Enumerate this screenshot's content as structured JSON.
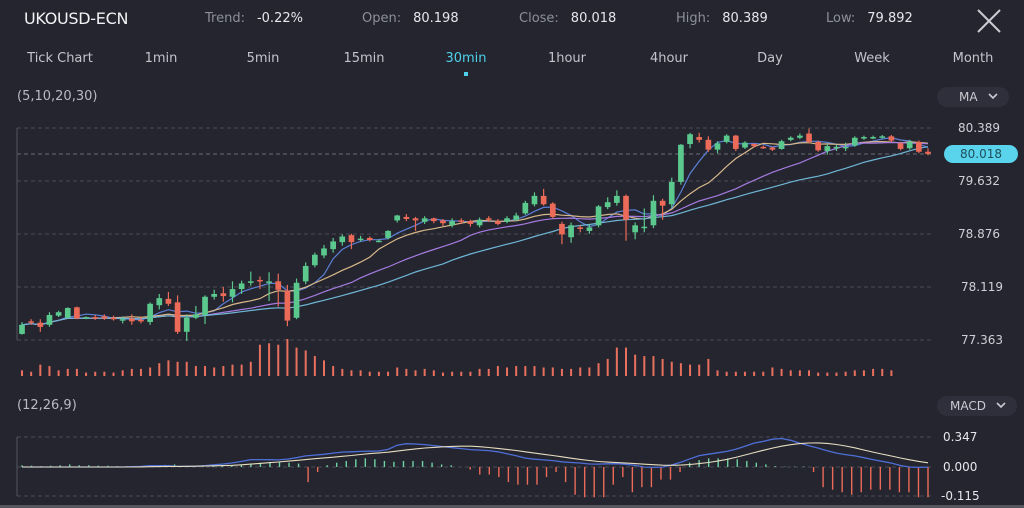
{
  "header": {
    "symbol": "UKOUSD-ECN",
    "stats": [
      {
        "label": "Trend:",
        "value": "-0.22%"
      },
      {
        "label": "Open:",
        "value": "80.198"
      },
      {
        "label": "Close:",
        "value": "80.018"
      },
      {
        "label": "High:",
        "value": "80.389"
      },
      {
        "label": "Low:",
        "value": "79.892"
      }
    ],
    "close_icon": "close-x-icon"
  },
  "timeframes": {
    "items": [
      "Tick Chart",
      "1min",
      "5min",
      "15min",
      "30min",
      "1hour",
      "4hour",
      "Day",
      "Week",
      "Month"
    ],
    "active": "30min"
  },
  "main_panel": {
    "params": "(5,10,20,30)",
    "indicator_select": "MA",
    "current_price": "80.018",
    "axis_labels": [
      "80.389",
      "79.632",
      "78.876",
      "78.119",
      "77.363"
    ]
  },
  "macd_panel": {
    "params": "(12,26,9)",
    "indicator_select": "MACD",
    "axis_labels": [
      "0.347",
      "0.000",
      "-0.115"
    ]
  },
  "colors": {
    "up": "#5bc98e",
    "down": "#ec6b58",
    "ma5": "#5b7fd6",
    "ma10": "#d9b98a",
    "ma20": "#a57be0",
    "ma30": "#6fb6d6",
    "accent": "#4fd0ea",
    "dif": "#4f6fd8",
    "dea": "#e6ddc0"
  },
  "chart_data": {
    "type": "candlestick",
    "title": "UKOUSD-ECN 30min",
    "ylim": [
      77.363,
      80.389
    ],
    "yticks": [
      80.389,
      79.632,
      78.876,
      78.119,
      77.363
    ],
    "grid": true,
    "current_price": 80.018,
    "candles": [
      [
        77.45,
        77.58,
        77.62,
        77.44
      ],
      [
        77.63,
        77.61,
        77.66,
        77.58
      ],
      [
        77.61,
        77.55,
        77.66,
        77.48
      ],
      [
        77.58,
        77.72,
        77.76,
        77.55
      ],
      [
        77.71,
        77.76,
        77.78,
        77.69
      ],
      [
        77.68,
        77.82,
        77.83,
        77.67
      ],
      [
        77.83,
        77.67,
        77.84,
        77.66
      ],
      [
        77.68,
        77.69,
        77.7,
        77.66
      ],
      [
        77.69,
        77.67,
        77.72,
        77.65
      ],
      [
        77.7,
        77.67,
        77.73,
        77.65
      ],
      [
        77.68,
        77.66,
        77.71,
        77.64
      ],
      [
        77.64,
        77.66,
        77.7,
        77.6
      ],
      [
        77.67,
        77.63,
        77.73,
        77.58
      ],
      [
        77.65,
        77.63,
        77.7,
        77.6
      ],
      [
        77.62,
        77.88,
        77.9,
        77.58
      ],
      [
        77.86,
        77.96,
        78.02,
        77.8
      ],
      [
        77.95,
        77.88,
        78.05,
        77.85
      ],
      [
        77.9,
        77.48,
        78.0,
        77.45
      ],
      [
        77.48,
        77.68,
        77.73,
        77.35
      ],
      [
        77.68,
        77.73,
        77.85,
        77.66
      ],
      [
        77.72,
        77.98,
        78.0,
        77.59
      ],
      [
        77.98,
        78.02,
        78.08,
        77.94
      ],
      [
        78.03,
        77.99,
        78.12,
        77.91
      ],
      [
        77.98,
        78.09,
        78.2,
        77.9
      ],
      [
        78.09,
        78.17,
        78.21,
        78.02
      ],
      [
        78.18,
        78.2,
        78.34,
        78.14
      ],
      [
        78.22,
        78.2,
        78.27,
        78.09
      ],
      [
        78.19,
        78.2,
        78.33,
        77.92
      ],
      [
        78.2,
        78.08,
        78.31,
        77.84
      ],
      [
        78.07,
        77.64,
        78.15,
        77.56
      ],
      [
        77.68,
        78.18,
        78.24,
        77.66
      ],
      [
        78.2,
        78.42,
        78.47,
        78.16
      ],
      [
        78.43,
        78.58,
        78.61,
        78.4
      ],
      [
        78.57,
        78.67,
        78.72,
        78.53
      ],
      [
        78.66,
        78.77,
        78.82,
        78.61
      ],
      [
        78.76,
        78.84,
        78.87,
        78.71
      ],
      [
        78.86,
        78.76,
        78.88,
        78.66
      ],
      [
        78.8,
        78.81,
        78.85,
        78.77
      ],
      [
        78.82,
        78.79,
        78.84,
        78.77
      ],
      [
        78.78,
        78.78,
        78.8,
        78.76
      ],
      [
        78.82,
        78.92,
        78.93,
        78.8
      ],
      [
        79.07,
        79.14,
        79.15,
        79.04
      ],
      [
        79.12,
        79.09,
        79.16,
        79.06
      ],
      [
        79.1,
        79.07,
        79.12,
        78.92
      ],
      [
        79.05,
        79.1,
        79.13,
        79.02
      ],
      [
        79.1,
        79.06,
        79.11,
        79.03
      ],
      [
        79.07,
        79.03,
        79.09,
        78.99
      ],
      [
        79.0,
        79.06,
        79.1,
        78.97
      ],
      [
        79.07,
        79.05,
        79.1,
        79.02
      ],
      [
        79.06,
        79.02,
        79.08,
        78.98
      ],
      [
        79.0,
        79.08,
        79.11,
        78.97
      ],
      [
        79.1,
        79.08,
        79.13,
        79.05
      ],
      [
        79.06,
        79.02,
        79.09,
        79.0
      ],
      [
        79.05,
        79.1,
        79.13,
        79.03
      ],
      [
        79.08,
        79.14,
        79.18,
        79.06
      ],
      [
        79.17,
        79.32,
        79.35,
        79.15
      ],
      [
        79.3,
        79.42,
        79.47,
        79.27
      ],
      [
        79.42,
        79.3,
        79.52,
        79.28
      ],
      [
        79.31,
        79.12,
        79.33,
        79.1
      ],
      [
        79.02,
        78.87,
        79.05,
        78.73
      ],
      [
        78.83,
        79.0,
        79.04,
        78.75
      ],
      [
        78.97,
        78.95,
        79.0,
        78.9
      ],
      [
        78.92,
        78.97,
        79.02,
        78.88
      ],
      [
        79.0,
        79.27,
        79.29,
        78.97
      ],
      [
        79.26,
        79.33,
        79.4,
        79.23
      ],
      [
        79.32,
        79.42,
        79.5,
        79.28
      ],
      [
        79.42,
        79.08,
        79.44,
        78.78
      ],
      [
        78.9,
        79.0,
        79.04,
        78.8
      ],
      [
        78.97,
        78.98,
        79.24,
        78.9
      ],
      [
        79.0,
        79.35,
        79.43,
        78.96
      ],
      [
        79.35,
        79.28,
        79.38,
        79.08
      ],
      [
        79.3,
        79.62,
        79.68,
        79.25
      ],
      [
        79.62,
        80.15,
        80.16,
        79.58
      ],
      [
        80.16,
        80.3,
        80.32,
        80.1
      ],
      [
        80.26,
        80.22,
        80.32,
        80.18
      ],
      [
        80.22,
        80.08,
        80.27,
        80.05
      ],
      [
        80.08,
        80.17,
        80.2,
        80.03
      ],
      [
        80.19,
        80.28,
        80.3,
        80.17
      ],
      [
        80.28,
        80.09,
        80.29,
        80.06
      ],
      [
        80.11,
        80.18,
        80.2,
        80.09
      ],
      [
        80.16,
        80.13,
        80.17,
        80.11
      ],
      [
        80.12,
        80.11,
        80.14,
        80.09
      ],
      [
        80.11,
        80.08,
        80.12,
        80.06
      ],
      [
        80.09,
        80.2,
        80.22,
        80.08
      ],
      [
        80.22,
        80.25,
        80.27,
        80.2
      ],
      [
        80.25,
        80.28,
        80.31,
        80.23
      ],
      [
        80.31,
        80.19,
        80.38,
        80.17
      ],
      [
        80.19,
        80.07,
        80.21,
        80.05
      ],
      [
        80.06,
        80.13,
        80.16,
        80.01
      ],
      [
        80.1,
        80.12,
        80.15,
        80.06
      ],
      [
        80.1,
        80.12,
        80.18,
        80.06
      ],
      [
        80.14,
        80.25,
        80.27,
        80.12
      ],
      [
        80.24,
        80.26,
        80.28,
        80.22
      ],
      [
        80.25,
        80.26,
        80.28,
        80.23
      ],
      [
        80.26,
        80.27,
        80.29,
        80.24
      ],
      [
        80.27,
        80.21,
        80.29,
        80.19
      ],
      [
        80.17,
        80.09,
        80.19,
        80.07
      ],
      [
        80.1,
        80.19,
        80.22,
        80.08
      ],
      [
        80.19,
        80.05,
        80.21,
        80.03
      ],
      [
        80.05,
        80.02,
        80.1,
        80.0
      ]
    ],
    "volume": [
      2,
      1.5,
      4,
      3.5,
      2,
      2.5,
      2.5,
      1.2,
      1.5,
      1.5,
      1.2,
      2,
      2.5,
      2.5,
      3,
      4.5,
      5.5,
      5,
      5,
      3.5,
      3.5,
      3,
      3.5,
      4,
      4,
      5,
      11,
      11.5,
      11,
      13,
      10,
      9,
      7,
      5.5,
      3.5,
      2.5,
      2,
      2,
      1.5,
      1.5,
      1.5,
      3,
      2.5,
      2,
      2.5,
      2,
      1.2,
      1.5,
      1.5,
      1.5,
      2.5,
      2.5,
      3.5,
      3,
      3.5,
      3.5,
      3.5,
      3,
      3,
      2.5,
      2.5,
      3,
      3,
      4.5,
      6,
      10,
      10,
      7.5,
      7,
      7,
      6,
      5,
      4.5,
      4,
      4,
      6,
      2,
      1.5,
      1.5,
      1.5,
      1.5,
      1.5,
      3,
      2.5,
      2,
      2,
      2,
      1.2,
      1.2,
      1.2,
      1.5,
      2,
      2,
      2.5,
      2.5,
      2
    ],
    "macd_hist": [
      0.02,
      0.015,
      0.01,
      0.015,
      0.02,
      0.03,
      0.02,
      0.02,
      0.015,
      0.015,
      0.01,
      0.01,
      0.01,
      0.005,
      0.015,
      0.025,
      0.03,
      0.01,
      0.005,
      0.005,
      0.01,
      0.01,
      0.02,
      0.03,
      0.04,
      0.05,
      0.06,
      0.06,
      0.05,
      0.04,
      -0.06,
      -0.02,
      0.02,
      0.05,
      0.07,
      0.09,
      0.1,
      0.09,
      0.07,
      0.06,
      0.07,
      0.07,
      0.07,
      0.05,
      0.03,
      0.02,
      0.0,
      -0.01,
      -0.03,
      -0.03,
      -0.04,
      -0.06,
      -0.07,
      -0.07,
      -0.07,
      -0.04,
      -0.02,
      -0.06,
      -0.11,
      -0.12,
      -0.12,
      -0.12,
      -0.07,
      -0.04,
      -0.1,
      -0.08,
      -0.08,
      -0.05,
      -0.05,
      -0.02,
      0.05,
      0.08,
      0.1,
      0.1,
      0.1,
      0.09,
      0.07,
      0.05,
      0.03,
      0.01,
      0.005,
      0.005,
      0.005,
      -0.02,
      -0.08,
      -0.09,
      -0.1,
      -0.11,
      -0.1,
      -0.09,
      -0.09,
      -0.09,
      -0.1,
      -0.1,
      -0.12,
      -0.12
    ],
    "macd_dif_range": [
      -0.115,
      0.347
    ]
  }
}
